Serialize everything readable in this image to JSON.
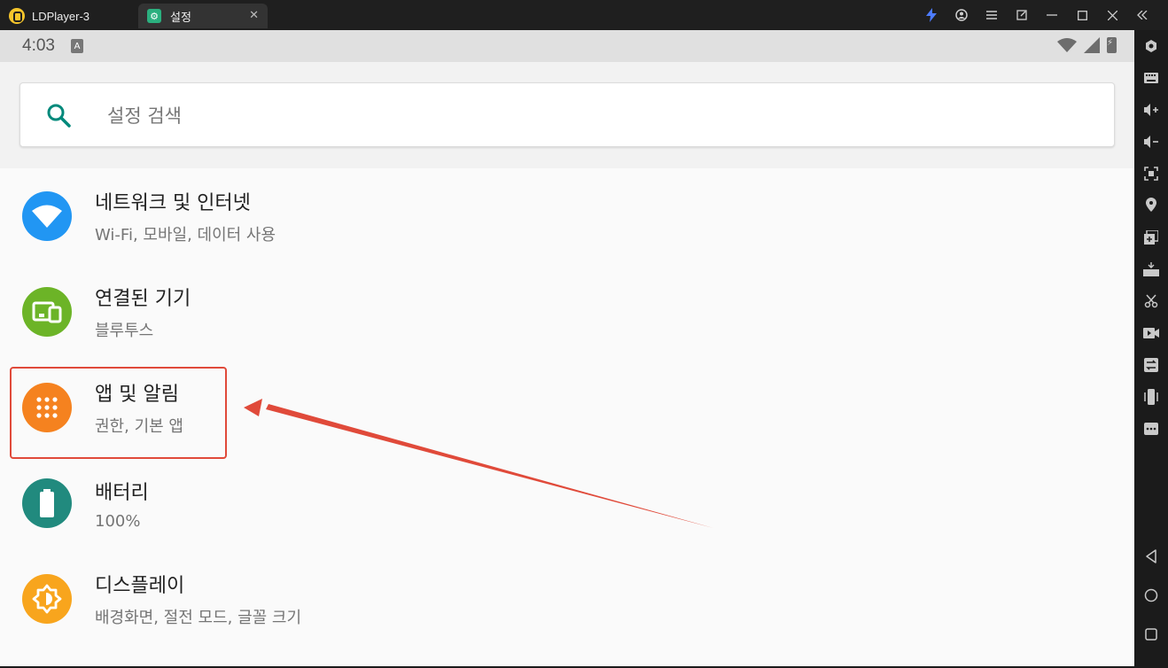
{
  "window": {
    "app_title": "LDPlayer-3",
    "tab_label": "설정",
    "tab_close": "✕",
    "icons": [
      "bolt-icon",
      "account-icon",
      "menu-icon",
      "popout-icon",
      "minimize-icon",
      "maximize-icon",
      "close-icon",
      "collapse-icon"
    ]
  },
  "status_bar": {
    "time": "4:03",
    "notification_badge": "A"
  },
  "search": {
    "placeholder": "설정 검색"
  },
  "settings": [
    {
      "title": "네트워크 및 인터넷",
      "subtitle": "Wi-Fi, 모바일, 데이터 사용",
      "icon": "wifi-icon",
      "color": "#2196f3"
    },
    {
      "title": "연결된 기기",
      "subtitle": "블루투스",
      "icon": "devices-icon",
      "color": "#6cb427"
    },
    {
      "title": "앱 및 알림",
      "subtitle": "권한, 기본 앱",
      "icon": "apps-grid-icon",
      "color": "#f5821f"
    },
    {
      "title": "배터리",
      "subtitle": "100%",
      "icon": "battery-icon",
      "color": "#218a7e"
    },
    {
      "title": "디스플레이",
      "subtitle": "배경화면, 절전 모드, 글꼴 크기",
      "icon": "brightness-icon",
      "color": "#f8a51d"
    }
  ],
  "sidebar_tools": [
    "settings-icon",
    "keyboard-icon",
    "volume-up-icon",
    "volume-down-icon",
    "screenshot-icon",
    "location-icon",
    "multi-window-icon",
    "apk-install-icon",
    "scissors-icon",
    "record-icon",
    "sync-icon",
    "shake-icon",
    "more-icon"
  ],
  "android_nav": [
    "back-icon",
    "home-icon",
    "recents-icon"
  ],
  "annotation": {
    "highlight_color": "#e04a3a"
  }
}
